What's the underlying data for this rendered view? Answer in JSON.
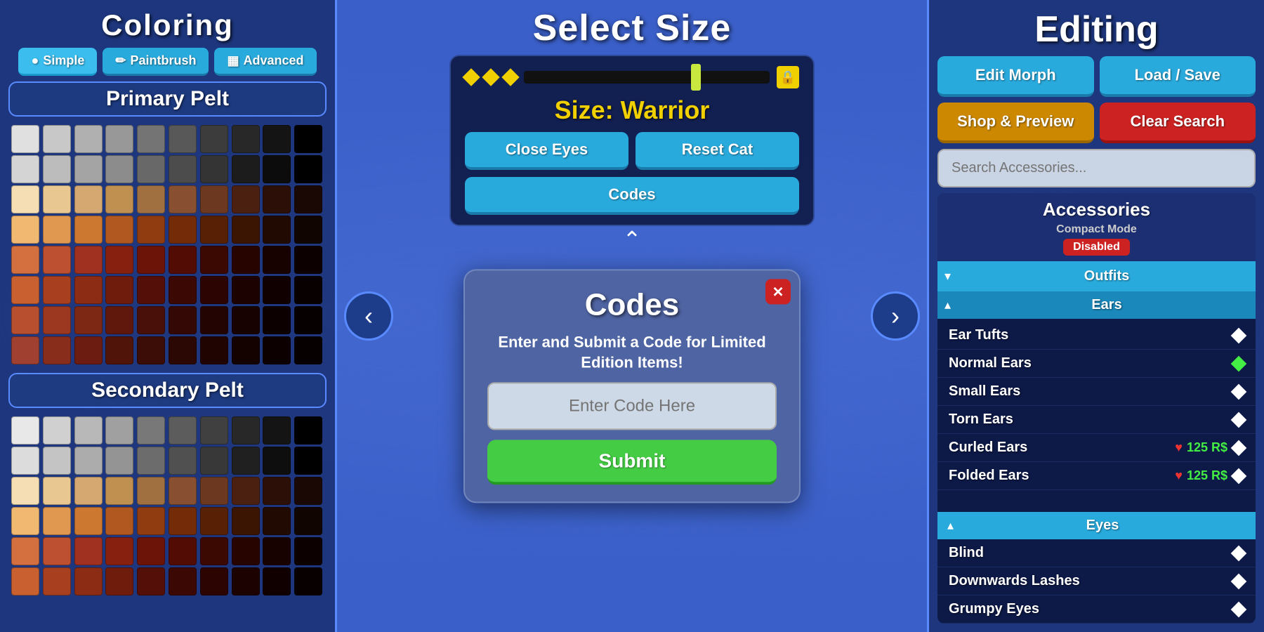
{
  "left": {
    "title": "Coloring",
    "tabs": [
      {
        "label": "Simple",
        "icon": "●",
        "active": true
      },
      {
        "label": "Paintbrush",
        "icon": "✏"
      },
      {
        "label": "Advanced",
        "icon": "▦"
      }
    ],
    "primary_pelt": "Primary Pelt",
    "secondary_pelt": "Secondary Pelt",
    "primary_colors": [
      "#e0e0e0",
      "#c8c8c8",
      "#b0b0b0",
      "#989898",
      "#747474",
      "#585858",
      "#3c3c3c",
      "#282828",
      "#141414",
      "#000000",
      "#d4d4d4",
      "#bcbcbc",
      "#a4a4a4",
      "#8c8c8c",
      "#686868",
      "#4c4c4c",
      "#343434",
      "#1c1c1c",
      "#0c0c0c",
      "#000000",
      "#f5deb3",
      "#e8c890",
      "#d4a870",
      "#c09050",
      "#a07040",
      "#885030",
      "#6c3820",
      "#4c2010",
      "#2c1008",
      "#1a0804",
      "#f0b870",
      "#e09850",
      "#cc7830",
      "#b05820",
      "#903c10",
      "#742c08",
      "#582004",
      "#3c1402",
      "#200a01",
      "#100501",
      "#d47040",
      "#bc5030",
      "#a03020",
      "#882010",
      "#6c1408",
      "#520c04",
      "#3c0802",
      "#280401",
      "#180200",
      "#0c0100",
      "#c86030",
      "#a84020",
      "#8c2c14",
      "#701c0c",
      "#541008",
      "#3c0804",
      "#2c0402",
      "#1c0201",
      "#100100",
      "#080000",
      "#b85030",
      "#9c3820",
      "#7c2814",
      "#60180c",
      "#481008",
      "#340804",
      "#240402",
      "#180201",
      "#0c0100",
      "#060000",
      "#a04030",
      "#882c1c",
      "#6c1c10",
      "#501408",
      "#3c0c06",
      "#2c0804",
      "#200402",
      "#140201",
      "#0c0100",
      "#060000"
    ],
    "secondary_colors": [
      "#e8e8e8",
      "#d0d0d0",
      "#b8b8b8",
      "#a0a0a0",
      "#787878",
      "#5c5c5c",
      "#404040",
      "#282828",
      "#141414",
      "#000000",
      "#dcdcdc",
      "#c4c4c4",
      "#acacac",
      "#949494",
      "#6c6c6c",
      "#505050",
      "#383838",
      "#202020",
      "#0e0e0e",
      "#000000"
    ]
  },
  "center": {
    "select_size_title": "Select Size",
    "size_label": "Size: Warrior",
    "close_eyes_btn": "Close Eyes",
    "reset_cat_btn": "Reset Cat",
    "codes_btn": "Codes",
    "chevron_up": "^",
    "modal": {
      "title": "Codes",
      "description": "Enter and Submit a Code for Limited Edition Items!",
      "input_placeholder": "Enter Code Here",
      "submit_btn": "Submit",
      "close": "✕"
    }
  },
  "right": {
    "title": "Editing",
    "edit_morph_btn": "Edit Morph",
    "load_save_btn": "Load / Save",
    "shop_preview_btn": "Shop & Preview",
    "clear_search_btn": "Clear Search",
    "search_placeholder": "Search Accessories...",
    "accessories": {
      "section_title": "Accessories",
      "compact_mode_label": "Compact Mode",
      "compact_mode_value": "Disabled",
      "outfits_label": "Outfits",
      "ears_label": "Ears",
      "items": [
        {
          "name": "Ear Tufts",
          "icon": "white",
          "price": null
        },
        {
          "name": "Normal Ears",
          "icon": "green",
          "price": null
        },
        {
          "name": "Small Ears",
          "icon": "white",
          "price": null
        },
        {
          "name": "Torn Ears",
          "icon": "white",
          "price": null
        },
        {
          "name": "Curled Ears",
          "has_price": true,
          "price": "125 R$"
        },
        {
          "name": "Folded Ears",
          "has_price": true,
          "price": "125 R$"
        }
      ],
      "eyes_section": "Eyes",
      "eye_items": [
        {
          "name": "Blind",
          "icon": "white"
        },
        {
          "name": "Downwards Lashes",
          "icon": "white"
        },
        {
          "name": "Grumpy Eyes",
          "icon": "white"
        }
      ]
    }
  }
}
